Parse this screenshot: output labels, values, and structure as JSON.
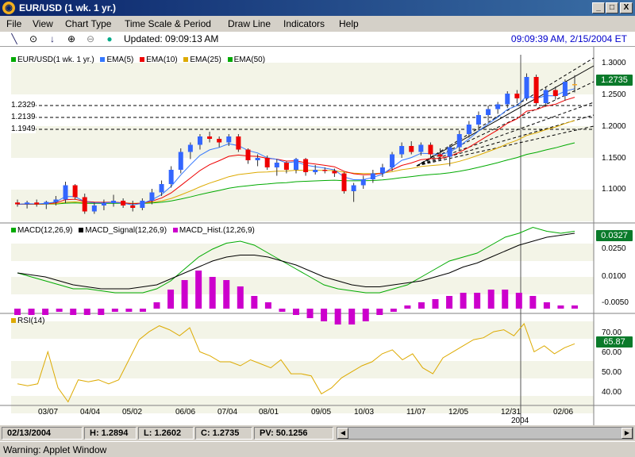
{
  "window": {
    "title": "EUR/USD (1 wk.  1 yr.)",
    "btn_min": "_",
    "btn_max": "□",
    "btn_close": "X"
  },
  "menu": [
    "File",
    "View",
    "Chart Type",
    "Time Scale & Period",
    "Draw Line",
    "Indicators",
    "Help"
  ],
  "toolbar": {
    "updated": "Updated: 09:09:13 AM",
    "clock": "09:09:39 AM, 2/15/2004 ET",
    "icons": [
      "line-tool-icon",
      "target-icon",
      "download-arrow-icon",
      "zoom-in-icon",
      "zoom-out-icon",
      "globe-icon"
    ]
  },
  "price_panel": {
    "legend": [
      {
        "label": "EUR/USD(1 wk.  1 yr.)",
        "color": "#00aa00"
      },
      {
        "label": "EMA(5)",
        "color": "#3377ff"
      },
      {
        "label": "EMA(10)",
        "color": "#ee0000"
      },
      {
        "label": "EMA(25)",
        "color": "#ddaa00"
      },
      {
        "label": "EMA(50)",
        "color": "#00aa00"
      }
    ],
    "ticks": [
      "1.3000",
      "1.2500",
      "1.2000",
      "1.1500",
      "1.1000"
    ],
    "last_value": "1.2735",
    "levels": [
      "1.2329",
      "1.2139",
      "1.1949"
    ]
  },
  "macd_panel": {
    "legend": [
      {
        "label": "MACD(12,26,9)",
        "color": "#00aa00"
      },
      {
        "label": "MACD_Signal(12,26,9)",
        "color": "#000000"
      },
      {
        "label": "MACD_Hist.(12,26,9)",
        "color": "#cc00cc"
      }
    ],
    "ticks": [
      "0.0250",
      "0.0100",
      "-0.0050"
    ],
    "last_value": "0.0327"
  },
  "rsi_panel": {
    "legend": [
      {
        "label": "RSI(14)",
        "color": "#ddaa00"
      }
    ],
    "ticks": [
      "70.00",
      "60.00",
      "50.00",
      "40.00"
    ],
    "last_value": "65.87"
  },
  "x_axis": {
    "labels": [
      "03/07",
      "04/04",
      "05/02",
      "06/06",
      "07/04",
      "08/01",
      "09/05",
      "10/03",
      "11/07",
      "12/05",
      "12/31",
      "02/06"
    ],
    "year_label": "2004"
  },
  "status": {
    "date": "02/13/2004",
    "high": "H: 1.2894",
    "low": "L: 1.2602",
    "close": "C: 1.2735",
    "pv": "PV: 50.1256"
  },
  "warning": "Warning: Applet Window",
  "colors": {
    "up": "#3366ff",
    "down": "#ee0000",
    "highlight": "#f5a623",
    "badge_green": "#0a7a2a"
  },
  "chart_data": [
    {
      "type": "candlestick",
      "title": "EUR/USD(1 wk.  1 yr.)",
      "ylim": [
        1.07,
        1.31
      ],
      "candles": [
        [
          1.075,
          1.08,
          1.068,
          1.072
        ],
        [
          1.072,
          1.078,
          1.065,
          1.075
        ],
        [
          1.075,
          1.08,
          1.068,
          1.072
        ],
        [
          1.072,
          1.078,
          1.064,
          1.076
        ],
        [
          1.076,
          1.086,
          1.07,
          1.08
        ],
        [
          1.08,
          1.11,
          1.074,
          1.104
        ],
        [
          1.104,
          1.106,
          1.08,
          1.084
        ],
        [
          1.084,
          1.09,
          1.056,
          1.06
        ],
        [
          1.06,
          1.075,
          1.056,
          1.07
        ],
        [
          1.07,
          1.08,
          1.062,
          1.074
        ],
        [
          1.074,
          1.088,
          1.068,
          1.078
        ],
        [
          1.078,
          1.082,
          1.066,
          1.07
        ],
        [
          1.07,
          1.078,
          1.06,
          1.066
        ],
        [
          1.066,
          1.082,
          1.062,
          1.078
        ],
        [
          1.078,
          1.098,
          1.072,
          1.092
        ],
        [
          1.092,
          1.112,
          1.086,
          1.106
        ],
        [
          1.106,
          1.136,
          1.1,
          1.13
        ],
        [
          1.13,
          1.166,
          1.124,
          1.16
        ],
        [
          1.16,
          1.176,
          1.148,
          1.172
        ],
        [
          1.172,
          1.19,
          1.164,
          1.186
        ],
        [
          1.186,
          1.194,
          1.176,
          1.182
        ],
        [
          1.182,
          1.186,
          1.168,
          1.176
        ],
        [
          1.176,
          1.19,
          1.17,
          1.186
        ],
        [
          1.186,
          1.19,
          1.16,
          1.164
        ],
        [
          1.164,
          1.166,
          1.14,
          1.146
        ],
        [
          1.146,
          1.156,
          1.136,
          1.15
        ],
        [
          1.15,
          1.154,
          1.13,
          1.134
        ],
        [
          1.134,
          1.148,
          1.12,
          1.142
        ],
        [
          1.142,
          1.144,
          1.124,
          1.13
        ],
        [
          1.13,
          1.15,
          1.124,
          1.148
        ],
        [
          1.148,
          1.15,
          1.12,
          1.126
        ],
        [
          1.126,
          1.138,
          1.122,
          1.13
        ],
        [
          1.13,
          1.134,
          1.124,
          1.128
        ],
        [
          1.128,
          1.132,
          1.118,
          1.124
        ],
        [
          1.124,
          1.126,
          1.09,
          1.094
        ],
        [
          1.094,
          1.108,
          1.076,
          1.104
        ],
        [
          1.104,
          1.12,
          1.098,
          1.114
        ],
        [
          1.114,
          1.13,
          1.108,
          1.124
        ],
        [
          1.124,
          1.14,
          1.118,
          1.134
        ],
        [
          1.134,
          1.16,
          1.128,
          1.156
        ],
        [
          1.156,
          1.176,
          1.15,
          1.17
        ],
        [
          1.17,
          1.178,
          1.156,
          1.16
        ],
        [
          1.16,
          1.176,
          1.154,
          1.172
        ],
        [
          1.172,
          1.176,
          1.15,
          1.156
        ],
        [
          1.156,
          1.166,
          1.146,
          1.152
        ],
        [
          1.152,
          1.172,
          1.136,
          1.168
        ],
        [
          1.168,
          1.196,
          1.162,
          1.19
        ],
        [
          1.19,
          1.212,
          1.184,
          1.206
        ],
        [
          1.206,
          1.228,
          1.2,
          1.222
        ],
        [
          1.222,
          1.238,
          1.212,
          1.232
        ],
        [
          1.232,
          1.244,
          1.224,
          1.24
        ],
        [
          1.24,
          1.262,
          1.234,
          1.258
        ],
        [
          1.258,
          1.264,
          1.242,
          1.25
        ],
        [
          1.25,
          1.292,
          1.246,
          1.286
        ],
        [
          1.286,
          1.29,
          1.238,
          1.242
        ],
        [
          1.242,
          1.27,
          1.236,
          1.264
        ],
        [
          1.264,
          1.27,
          1.248,
          1.254
        ],
        [
          1.254,
          1.282,
          1.246,
          1.278
        ],
        [
          1.272,
          1.289,
          1.26,
          1.274
        ]
      ]
    },
    {
      "type": "line",
      "title": "MACD(12,26,9)",
      "ylim": [
        -0.008,
        0.032
      ],
      "series": [
        {
          "name": "MACD(12,26,9)",
          "values": [
            0.01,
            0.008,
            0.006,
            0.004,
            0.002,
            0.002,
            0.001,
            0.0,
            0.0,
            0.0,
            0.002,
            0.006,
            0.012,
            0.018,
            0.022,
            0.025,
            0.026,
            0.024,
            0.02,
            0.016,
            0.012,
            0.008,
            0.004,
            0.002,
            0.001,
            0.0,
            0.0,
            0.002,
            0.004,
            0.008,
            0.012,
            0.016,
            0.018,
            0.02,
            0.024,
            0.028,
            0.03,
            0.033,
            0.031,
            0.03,
            0.031
          ]
        },
        {
          "name": "MACD_Signal(12,26,9)",
          "values": [
            0.01,
            0.009,
            0.008,
            0.006,
            0.004,
            0.003,
            0.002,
            0.002,
            0.002,
            0.003,
            0.004,
            0.007,
            0.01,
            0.013,
            0.016,
            0.018,
            0.019,
            0.019,
            0.018,
            0.016,
            0.014,
            0.011,
            0.008,
            0.006,
            0.004,
            0.003,
            0.003,
            0.004,
            0.005,
            0.006,
            0.008,
            0.01,
            0.013,
            0.015,
            0.018,
            0.021,
            0.024,
            0.026,
            0.028,
            0.029,
            0.03
          ]
        },
        {
          "name": "MACD_Hist.(12,26,9)",
          "values": [
            -0.002,
            -0.002,
            -0.002,
            -0.001,
            -0.002,
            -0.002,
            -0.002,
            -0.001,
            -0.001,
            0.0,
            0.002,
            0.006,
            0.009,
            0.012,
            0.01,
            0.009,
            0.007,
            0.004,
            0.002,
            0.0,
            -0.002,
            -0.003,
            -0.004,
            -0.005,
            -0.005,
            -0.004,
            -0.002,
            0.0,
            0.001,
            0.002,
            0.003,
            0.004,
            0.005,
            0.005,
            0.006,
            0.006,
            0.005,
            0.004,
            0.002,
            0.001,
            0.001
          ]
        }
      ]
    },
    {
      "type": "line",
      "title": "RSI(14)",
      "ylim": [
        36,
        78
      ],
      "series": [
        {
          "name": "RSI(14)",
          "values": [
            46,
            45,
            46,
            62,
            44,
            37,
            48,
            47,
            48,
            46,
            48,
            58,
            68,
            72,
            75,
            73,
            70,
            74,
            62,
            60,
            57,
            57,
            55,
            58,
            56,
            54,
            58,
            51,
            51,
            50,
            41,
            44,
            49,
            52,
            55,
            57,
            61,
            63,
            58,
            61,
            54,
            51,
            59,
            62,
            65,
            68,
            69,
            72,
            73,
            70,
            76,
            62,
            65,
            61,
            64,
            66
          ]
        }
      ]
    }
  ]
}
